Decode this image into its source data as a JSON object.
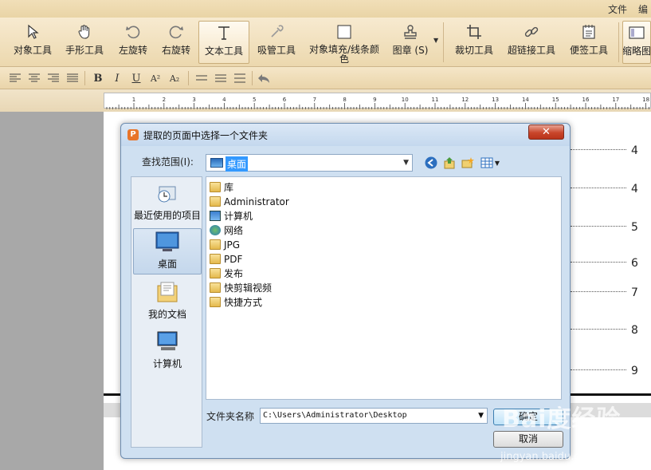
{
  "menu": [
    "文件",
    "编"
  ],
  "toolbar": {
    "tools": [
      {
        "id": "object",
        "label": "对象工具"
      },
      {
        "id": "hand",
        "label": "手形工具"
      },
      {
        "id": "rotate-left",
        "label": "左旋转"
      },
      {
        "id": "rotate-right",
        "label": "右旋转"
      },
      {
        "id": "text",
        "label": "文本工具",
        "active": true
      },
      {
        "id": "eyedropper",
        "label": "吸管工具"
      },
      {
        "id": "fill-line-color",
        "label": "对象填充/线条颜色"
      },
      {
        "id": "stamp",
        "label": "图章 (S)"
      },
      {
        "id": "crop",
        "label": "裁切工具"
      },
      {
        "id": "hyperlink",
        "label": "超链接工具"
      },
      {
        "id": "note",
        "label": "便签工具"
      },
      {
        "id": "thumbnail",
        "label": "缩略图"
      }
    ]
  },
  "format_bar": {
    "bold": "B",
    "italic": "I",
    "underline": "U",
    "superscript": "A²",
    "subscript": "A₂"
  },
  "ruler": {
    "numbers": [
      "1",
      "2",
      "3",
      "4",
      "5",
      "6",
      "7",
      "8",
      "9",
      "10",
      "11",
      "12",
      "13",
      "14",
      "15",
      "16",
      "17",
      "18"
    ]
  },
  "document": {
    "line_numbers": [
      "4",
      "4",
      "5",
      "6",
      "7",
      "8",
      "9"
    ]
  },
  "dialog": {
    "title": "提取的页面中选择一个文件夹",
    "close": "✕",
    "look_in_label": "查找范围(I):",
    "look_in_value": "桌面",
    "places": [
      {
        "id": "recent",
        "label": "最近使用的项目"
      },
      {
        "id": "desktop",
        "label": "桌面",
        "selected": true
      },
      {
        "id": "documents",
        "label": "我的文档"
      },
      {
        "id": "computer",
        "label": "计算机"
      }
    ],
    "files": [
      {
        "name": "库",
        "icon": "library-icon"
      },
      {
        "name": "Administrator",
        "icon": "user-folder-icon"
      },
      {
        "name": "计算机",
        "icon": "computer-icon"
      },
      {
        "name": "网络",
        "icon": "network-icon"
      },
      {
        "name": "JPG",
        "icon": "folder-icon"
      },
      {
        "name": "PDF",
        "icon": "folder-icon"
      },
      {
        "name": "发布",
        "icon": "folder-icon"
      },
      {
        "name": "快剪辑视频",
        "icon": "folder-icon"
      },
      {
        "name": "快捷方式",
        "icon": "folder-icon"
      }
    ],
    "folder_name_label": "文件夹名称",
    "folder_name_value": "C:\\Users\\Administrator\\Desktop",
    "ok": "确定",
    "cancel": "取消"
  },
  "watermark": {
    "brand": "Bai度经验",
    "url": "jingyan.baidu.com"
  }
}
